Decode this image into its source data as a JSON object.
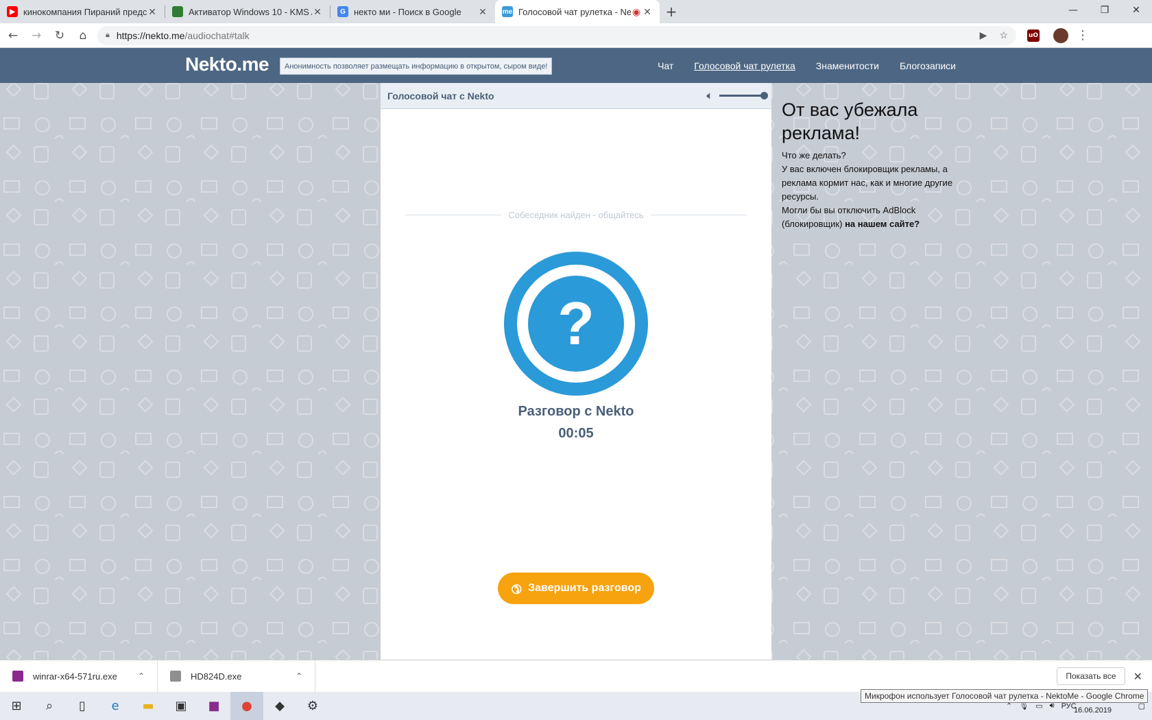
{
  "browser": {
    "tabs": [
      {
        "title": "кинокомпания Пираний предст",
        "favicon_color": "#ff0000"
      },
      {
        "title": "Активатор Windows 10 - KMS Au",
        "favicon_color": "#2e7d32"
      },
      {
        "title": "некто ми - Поиск в Google",
        "favicon_color": "#4285f4"
      },
      {
        "title": "Голосовой чат рулетка - Ne",
        "favicon_color": "#3a9ad9",
        "favicon_text": "me"
      }
    ],
    "url_host": "https://nekto.me",
    "url_path": "/audiochat#talk"
  },
  "site": {
    "logo": "Nekto.me",
    "slogan": "Анонимность позволяет размещать информацию в открытом, сыром виде!",
    "menu": [
      "Чат",
      "Голосовой чат рулетка",
      "Знаменитости",
      "Блогозаписи"
    ],
    "panel_title": "Голосовой чат с Nekto",
    "volume_level": 1.0,
    "found_text": "Собеседник найден - общайтесь",
    "avatar_symbol": "?",
    "talk_title": "Разговор с Nekto",
    "timer": "00:05",
    "end_button": "Завершить разговор",
    "ad": {
      "heading": "От вас убежала реклама!",
      "line1": "Что же делать?",
      "line2": "У вас включен блокировщик рекламы, а реклама кормит нас, как и многие другие ресурсы.",
      "line3": "Могли бы вы отключить AdBlock (блокировщик)",
      "line3_bold": "на нашем сайте?"
    }
  },
  "downloads": {
    "items": [
      "winrar-x64-571ru.exe",
      "HD824D.exe"
    ],
    "show_all": "Показать все"
  },
  "taskbar": {
    "tooltip": "Микрофон использует Голосовой чат рулетка - NektoMe - Google Chrome",
    "lang": "РУС",
    "date": "16.06.2019"
  }
}
